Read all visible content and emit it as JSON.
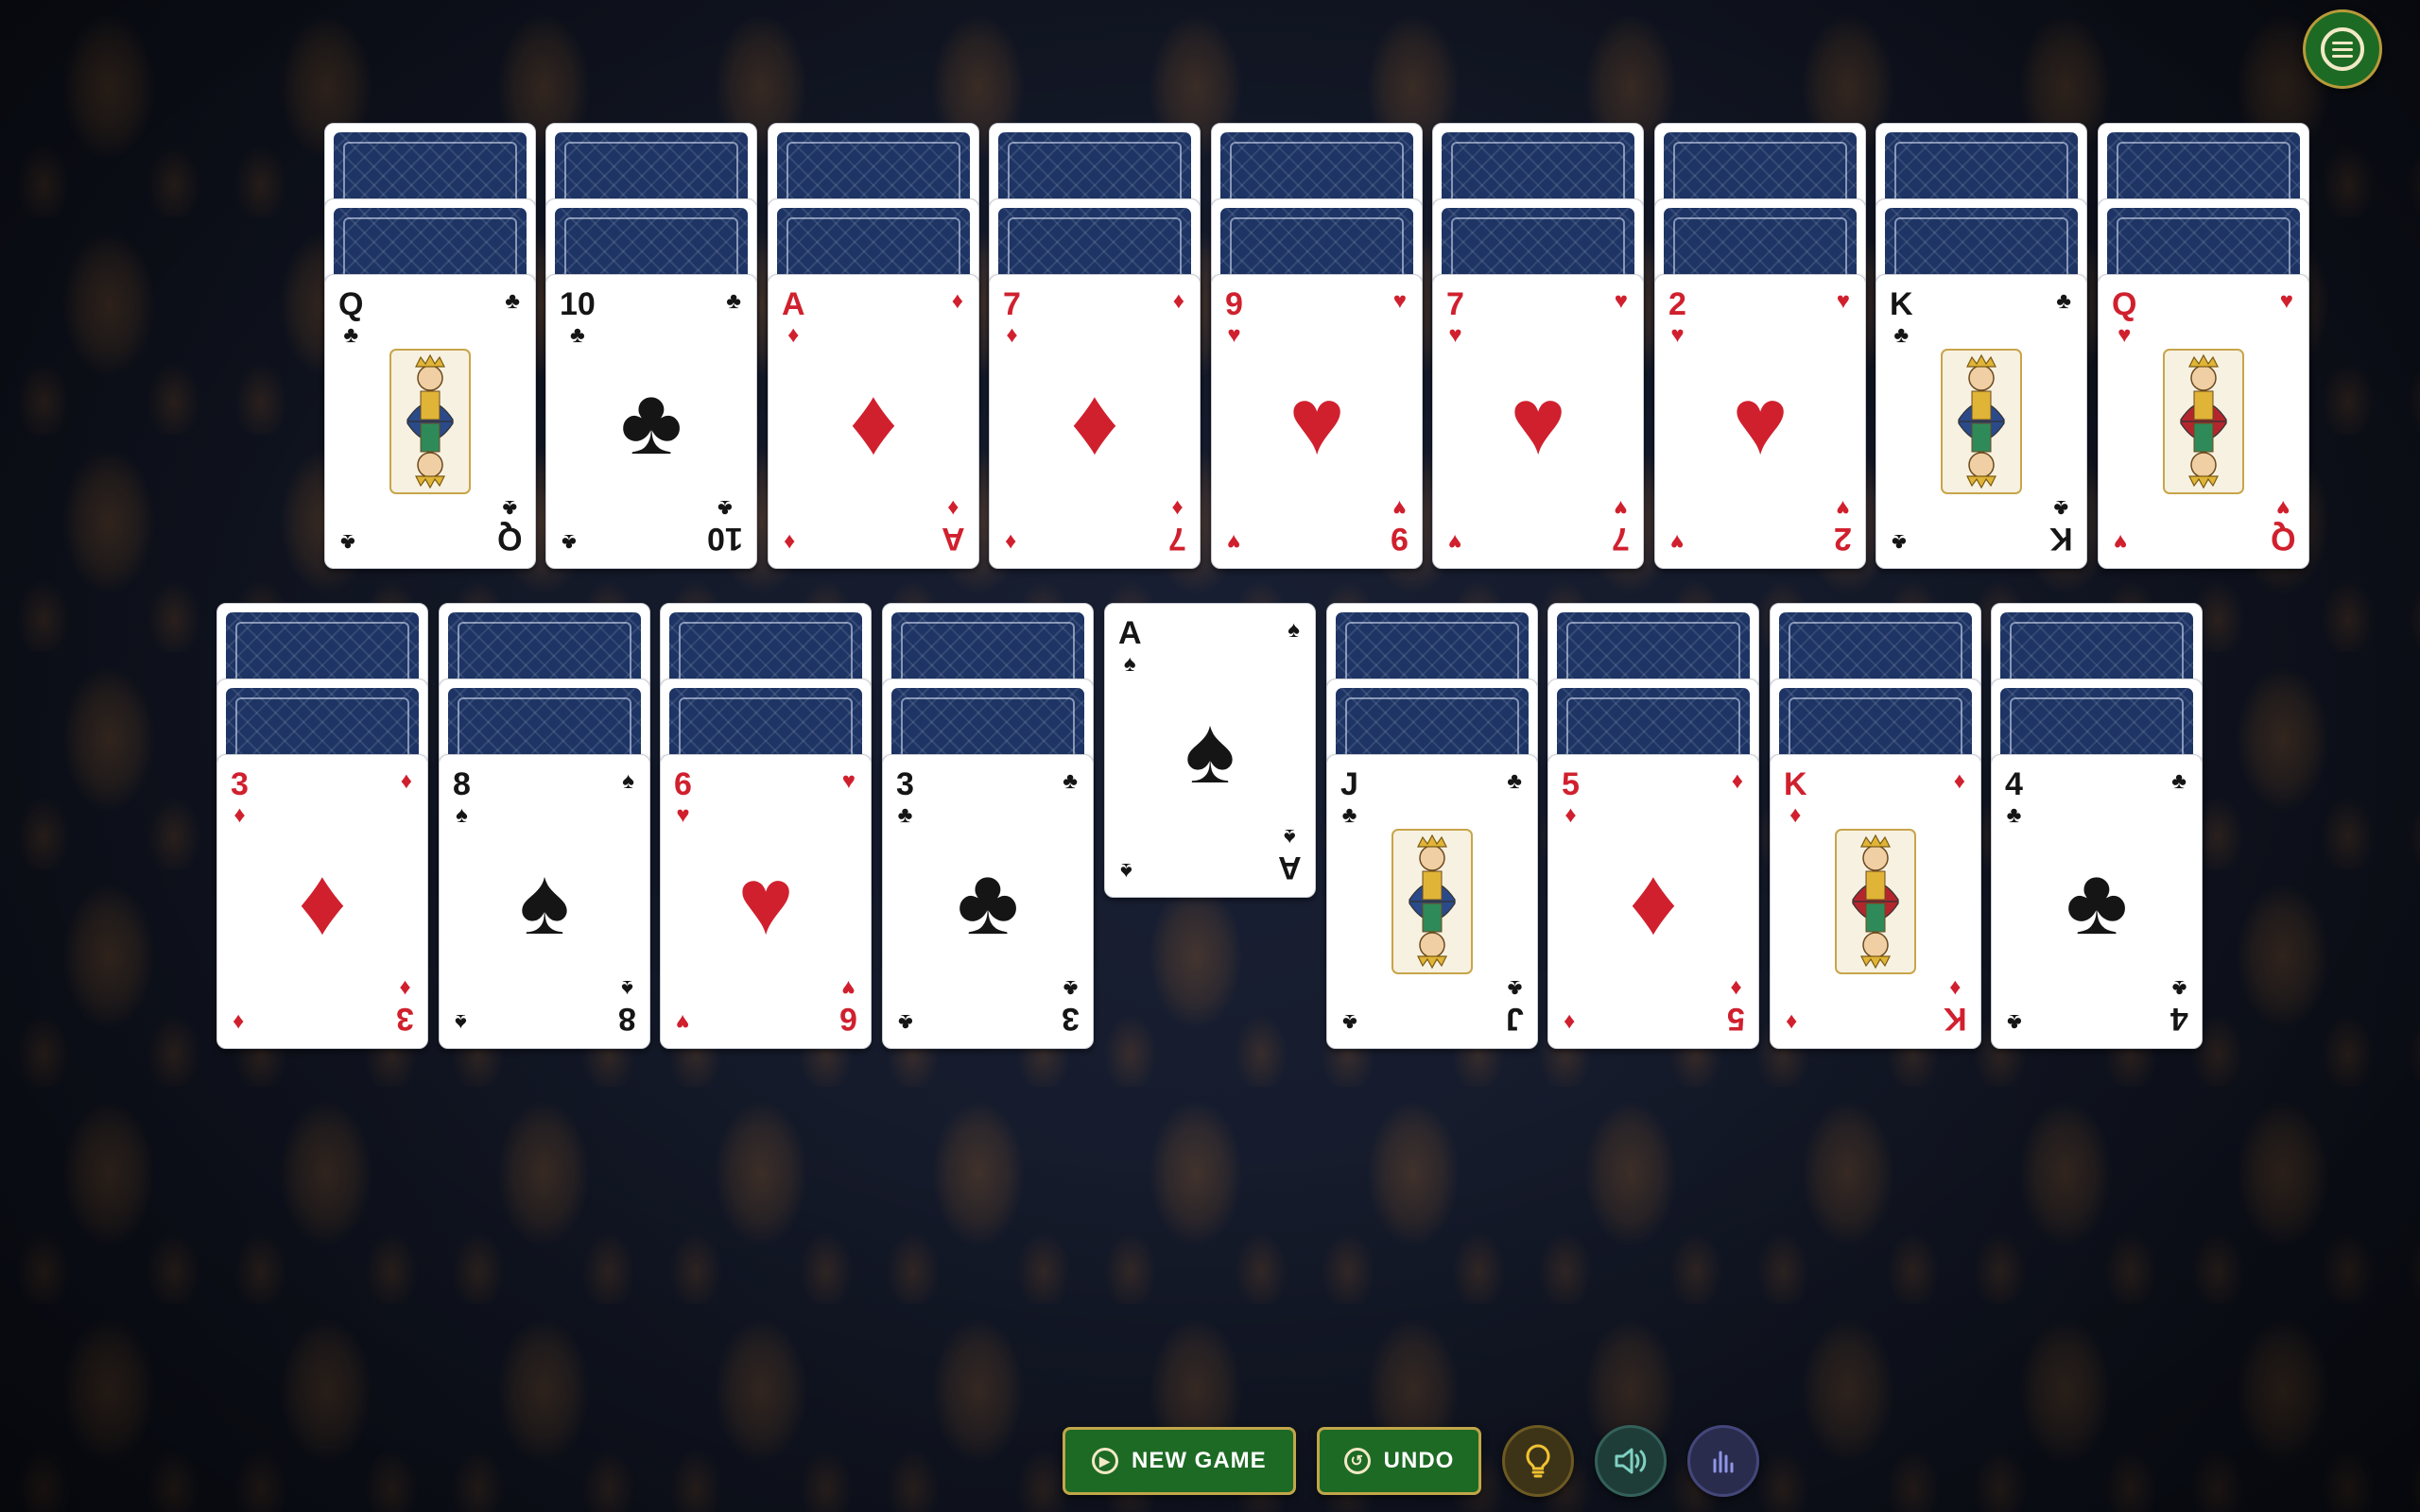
{
  "colors": {
    "red_suit": "#d0202e",
    "black_suit": "#151515",
    "card_back": "#1d3464",
    "button_green": "#1d6a24",
    "button_border": "#c2a64a",
    "background": "#161b28"
  },
  "tableau": {
    "top_row": [
      {
        "hidden_cards": 2,
        "face": {
          "rank": "Q",
          "suit": "♣",
          "color": "black",
          "court": true
        }
      },
      {
        "hidden_cards": 2,
        "face": {
          "rank": "10",
          "suit": "♣",
          "color": "black",
          "court": false
        }
      },
      {
        "hidden_cards": 2,
        "face": {
          "rank": "A",
          "suit": "♦",
          "color": "red",
          "court": false
        }
      },
      {
        "hidden_cards": 2,
        "face": {
          "rank": "7",
          "suit": "♦",
          "color": "red",
          "court": false
        }
      },
      {
        "hidden_cards": 2,
        "face": {
          "rank": "9",
          "suit": "♥",
          "color": "red",
          "court": false
        }
      },
      {
        "hidden_cards": 2,
        "face": {
          "rank": "7",
          "suit": "♥",
          "color": "red",
          "court": false
        }
      },
      {
        "hidden_cards": 2,
        "face": {
          "rank": "2",
          "suit": "♥",
          "color": "red",
          "court": false
        }
      },
      {
        "hidden_cards": 2,
        "face": {
          "rank": "K",
          "suit": "♣",
          "color": "black",
          "court": true
        }
      },
      {
        "hidden_cards": 2,
        "face": {
          "rank": "Q",
          "suit": "♥",
          "color": "red",
          "court": true
        }
      }
    ],
    "bottom_row": [
      {
        "hidden_cards": 2,
        "face": {
          "rank": "3",
          "suit": "♦",
          "color": "red",
          "court": false
        }
      },
      {
        "hidden_cards": 2,
        "face": {
          "rank": "8",
          "suit": "♠",
          "color": "black",
          "court": false
        }
      },
      {
        "hidden_cards": 2,
        "face": {
          "rank": "6",
          "suit": "♥",
          "color": "red",
          "court": false
        }
      },
      {
        "hidden_cards": 2,
        "face": {
          "rank": "3",
          "suit": "♣",
          "color": "black",
          "court": false
        }
      },
      {
        "hidden_cards": 0,
        "face": {
          "rank": "A",
          "suit": "♠",
          "color": "black",
          "court": false
        }
      },
      {
        "hidden_cards": 2,
        "face": {
          "rank": "J",
          "suit": "♣",
          "color": "black",
          "court": true
        }
      },
      {
        "hidden_cards": 2,
        "face": {
          "rank": "5",
          "suit": "♦",
          "color": "red",
          "court": false
        }
      },
      {
        "hidden_cards": 2,
        "face": {
          "rank": "K",
          "suit": "♦",
          "color": "red",
          "court": true
        }
      },
      {
        "hidden_cards": 2,
        "face": {
          "rank": "4",
          "suit": "♣",
          "color": "black",
          "court": false
        }
      }
    ]
  },
  "toolbar": {
    "new_game_label": "NEW GAME",
    "new_game_icon": "play-circle-icon",
    "undo_label": "UNDO",
    "undo_icon": "undo-arrow-icon",
    "hint_icon": "lightbulb-icon",
    "sound_icon": "speaker-icon",
    "stats_icon": "bar-chart-icon"
  },
  "menu": {
    "icon": "hamburger-menu-icon"
  }
}
